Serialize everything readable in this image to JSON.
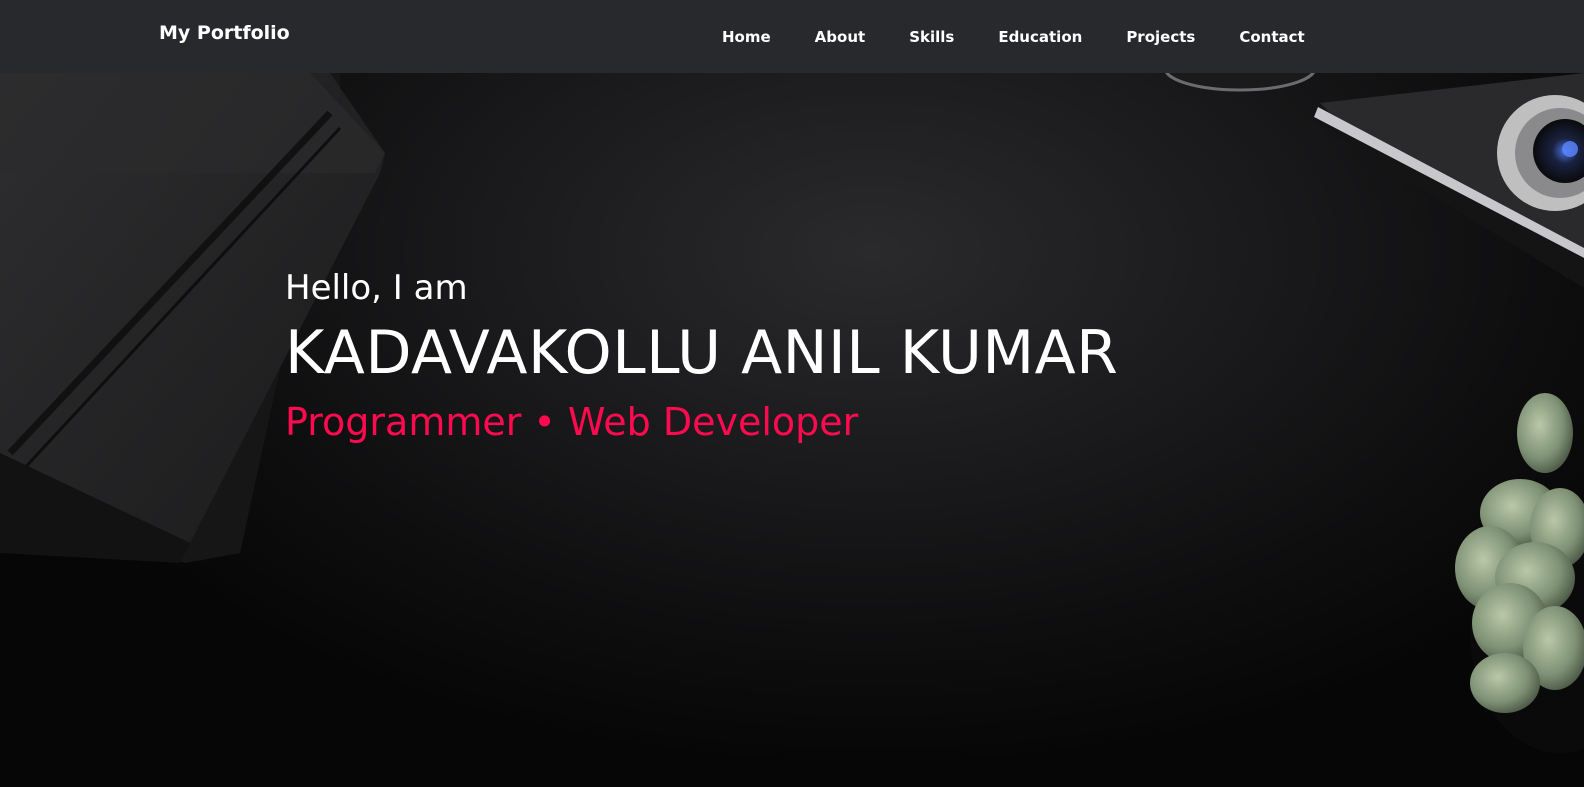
{
  "navbar": {
    "brand": "My Portfolio",
    "links": [
      "Home",
      "About",
      "Skills",
      "Education",
      "Projects",
      "Contact"
    ]
  },
  "hero": {
    "greeting": "Hello, I am",
    "name": "KADAVAKOLLU ANIL KUMAR",
    "roles": "Programmer • Web Developer",
    "accent_color": "#ff0a4f"
  },
  "icons": [
    "notebook-image",
    "camera-image",
    "succulent-plant-image"
  ]
}
